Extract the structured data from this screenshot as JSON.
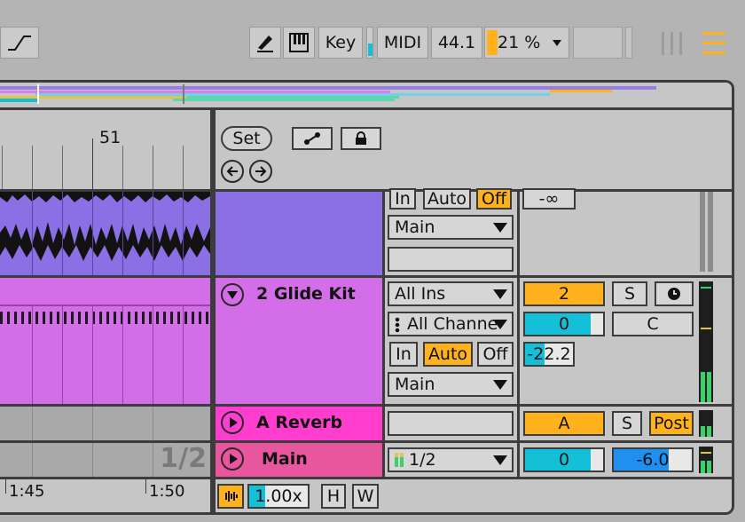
{
  "toolbar": {
    "automation_label": "",
    "key_label": "Key",
    "midi_label": "MIDI",
    "sample_rate": "44.1",
    "cpu_value": "21 %"
  },
  "arrangement": {
    "bar_marker": "51",
    "time_left": "1:45",
    "time_right": "1:50",
    "page_indicator": "1/2"
  },
  "mixer_header": {
    "set_label": "Set"
  },
  "tracks": {
    "top": {
      "in_label": "In",
      "auto_label": "Auto",
      "off_label": "Off",
      "output": "Main",
      "volume": "-∞"
    },
    "glide_kit": {
      "name": "2 Glide Kit",
      "input_type": "All Ins",
      "input_channel": "All Channe",
      "in_label": "In",
      "auto_label": "Auto",
      "off_label": "Off",
      "output": "Main",
      "track_number": "2",
      "solo_label": "S",
      "pan": "C",
      "send_value": "0",
      "volume": "-22.2"
    },
    "reverb": {
      "name": "A Reverb",
      "letter": "A",
      "solo_label": "S",
      "post_label": "Post"
    },
    "main": {
      "name": "Main",
      "cue_out": "1/2",
      "send_value": "0",
      "volume": "-6.0"
    }
  },
  "bottom": {
    "tempo_ratio": "1.00x",
    "h_label": "H",
    "w_label": "W"
  },
  "colors": {
    "accent": "#ffb21c",
    "purple_clip": "#8a70e4",
    "pink_clip": "#d46de8",
    "reverb": "#ff3dcf",
    "main": "#e8579e",
    "cyan": "#14c0d8"
  }
}
